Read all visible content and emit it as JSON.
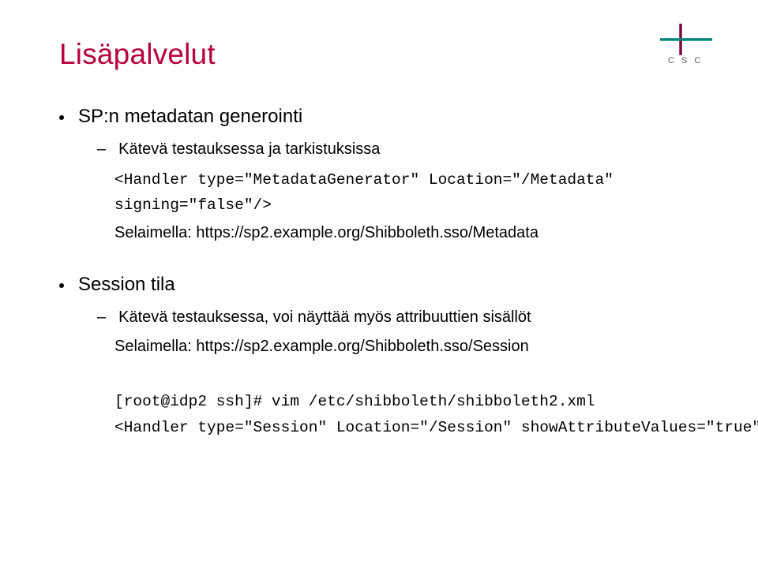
{
  "title": "Lisäpalvelut",
  "logo": {
    "brand": "CSC"
  },
  "block1": {
    "heading": "SP:n metadatan generointi",
    "sub": "Kätevä testauksessa ja tarkistuksissa",
    "code1": "<Handler type=\"MetadataGenerator\" Location=\"/Metadata\"",
    "code2": "signing=\"false\"/>",
    "selaimella": "Selaimella: https://sp2.example.org/Shibboleth.sso/Metadata"
  },
  "block2": {
    "heading": "Session tila",
    "sub": "Kätevä testauksessa, voi näyttää myös attribuuttien sisällöt",
    "selaimella": "Selaimella: https://sp2.example.org/Shibboleth.sso/Session"
  },
  "terminal": {
    "line1": "[root@idp2 ssh]# vim /etc/shibboleth/shibboleth2.xml",
    "line2": "<Handler type=\"Session\" Location=\"/Session\" showAttributeValues=\"true\" />"
  }
}
